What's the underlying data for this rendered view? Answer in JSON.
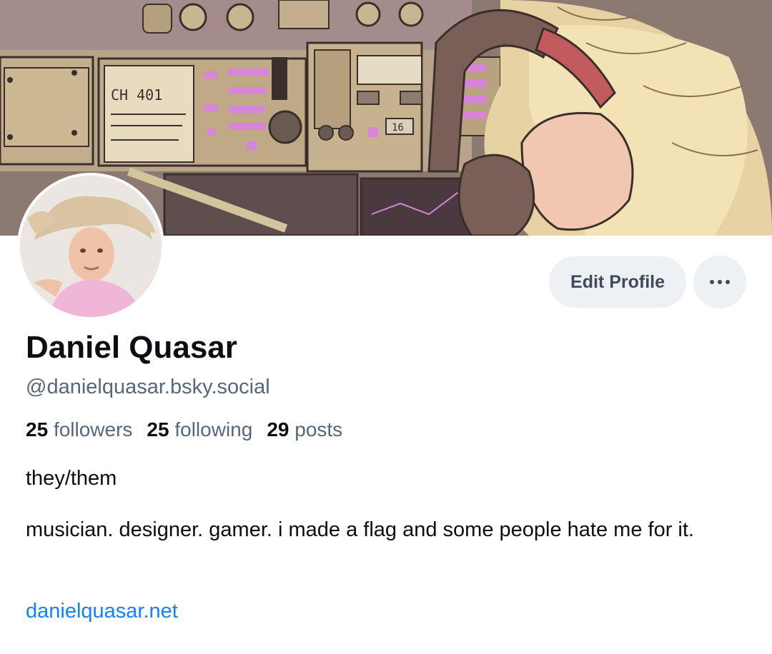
{
  "profile": {
    "display_name": "Daniel Quasar",
    "handle": "@danielquasar.bsky.social",
    "stats": {
      "followers_count": "25",
      "followers_label": "followers",
      "following_count": "25",
      "following_label": "following",
      "posts_count": "29",
      "posts_label": "posts"
    },
    "bio_line1": "they/them",
    "bio_line2": "musician. designer. gamer. i made a flag and some people hate me for it.",
    "website": "danielquasar.net"
  },
  "actions": {
    "edit_label": "Edit Profile",
    "more_icon": "ellipsis-icon"
  },
  "banner": {
    "panel_label": "CH 401",
    "small_label": "16"
  },
  "colors": {
    "link": "#1083fe",
    "muted": "#56677a",
    "button_bg": "#eef1f4",
    "text": "#0b0f14"
  }
}
